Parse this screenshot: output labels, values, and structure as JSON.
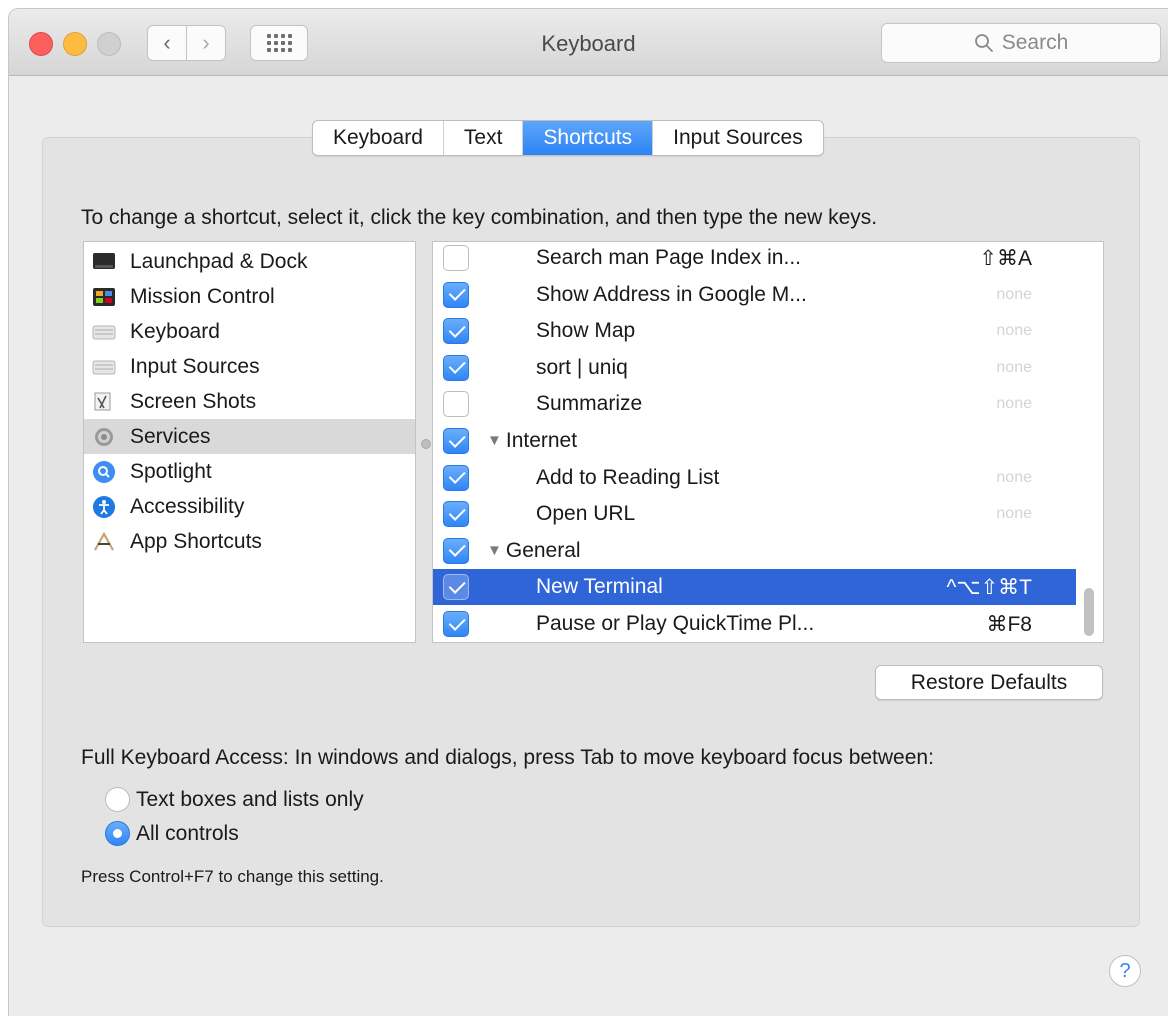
{
  "window": {
    "title": "Keyboard"
  },
  "toolbar": {
    "back_icon": "‹",
    "forward_icon": "›",
    "search_placeholder": "Search"
  },
  "tabs": [
    {
      "label": "Keyboard",
      "active": false
    },
    {
      "label": "Text",
      "active": false
    },
    {
      "label": "Shortcuts",
      "active": true
    },
    {
      "label": "Input Sources",
      "active": false
    }
  ],
  "instruction": "To change a shortcut, select it, click the key combination, and then type the new keys.",
  "categories": [
    {
      "label": "Launchpad & Dock",
      "icon": "launchpad-icon",
      "selected": false
    },
    {
      "label": "Mission Control",
      "icon": "mission-control-icon",
      "selected": false
    },
    {
      "label": "Keyboard",
      "icon": "keyboard-icon",
      "selected": false
    },
    {
      "label": "Input Sources",
      "icon": "input-sources-icon",
      "selected": false
    },
    {
      "label": "Screen Shots",
      "icon": "screenshot-icon",
      "selected": false
    },
    {
      "label": "Services",
      "icon": "gear-icon",
      "selected": true
    },
    {
      "label": "Spotlight",
      "icon": "spotlight-icon",
      "selected": false
    },
    {
      "label": "Accessibility",
      "icon": "accessibility-icon",
      "selected": false
    },
    {
      "label": "App Shortcuts",
      "icon": "app-shortcuts-icon",
      "selected": false
    }
  ],
  "shortcuts": [
    {
      "kind": "item",
      "name": "Search man Page Index in...",
      "checked": false,
      "key": "⇧⌘A",
      "selected": false
    },
    {
      "kind": "item",
      "name": "Show Address in Google M...",
      "checked": true,
      "key": "none",
      "selected": false
    },
    {
      "kind": "item",
      "name": "Show Map",
      "checked": true,
      "key": "none",
      "selected": false
    },
    {
      "kind": "item",
      "name": "sort | uniq",
      "checked": true,
      "key": "none",
      "selected": false
    },
    {
      "kind": "item",
      "name": "Summarize",
      "checked": false,
      "key": "none",
      "selected": false
    },
    {
      "kind": "group",
      "name": "Internet",
      "checked": true,
      "key": "",
      "selected": false
    },
    {
      "kind": "item",
      "name": "Add to Reading List",
      "checked": true,
      "key": "none",
      "selected": false
    },
    {
      "kind": "item",
      "name": "Open URL",
      "checked": true,
      "key": "none",
      "selected": false
    },
    {
      "kind": "group",
      "name": "General",
      "checked": true,
      "key": "",
      "selected": false
    },
    {
      "kind": "item",
      "name": "New Terminal",
      "checked": true,
      "key": "^⌥⇧⌘T",
      "selected": true
    },
    {
      "kind": "item",
      "name": "Pause or Play QuickTime Pl...",
      "checked": true,
      "key": "⌘F8",
      "selected": false
    }
  ],
  "restore_defaults": "Restore Defaults",
  "full_keyboard_access": {
    "label": "Full Keyboard Access: In windows and dialogs, press Tab to move keyboard focus between:",
    "options": [
      {
        "label": "Text boxes and lists only",
        "selected": false
      },
      {
        "label": "All controls",
        "selected": true
      }
    ],
    "note": "Press Control+F7 to change this setting."
  },
  "help": "?"
}
